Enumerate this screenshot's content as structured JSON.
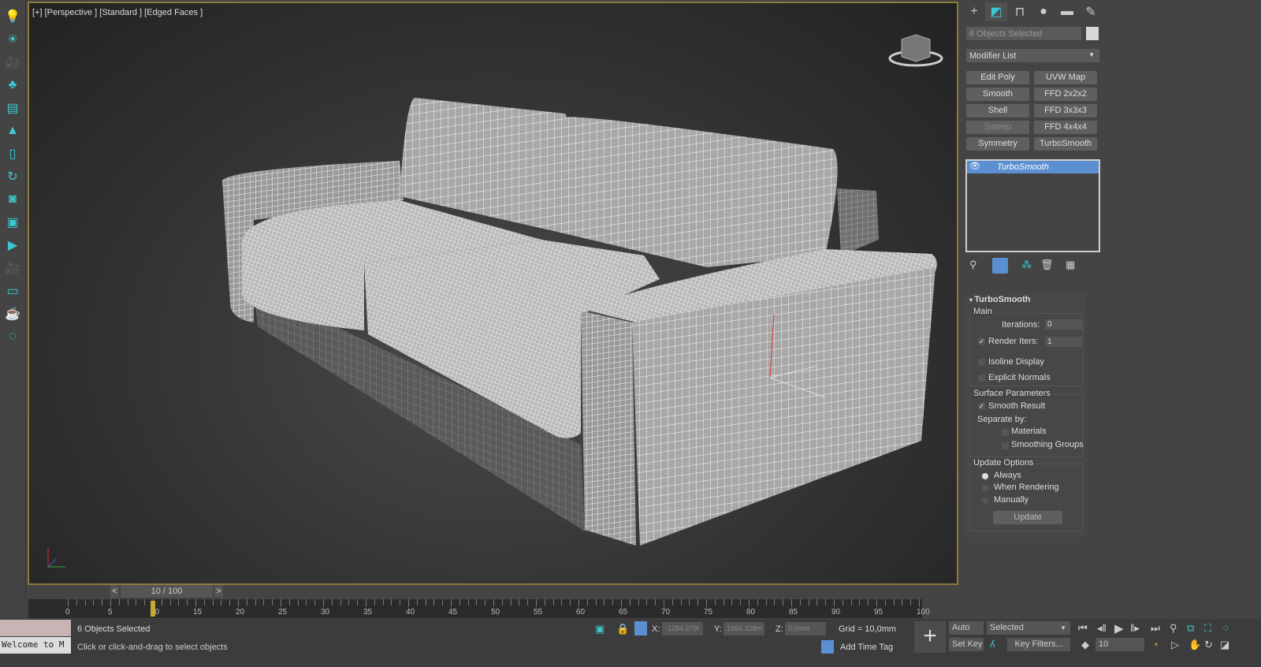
{
  "viewport": {
    "label": "[+] [Perspective ] [Standard ] [Edged Faces ]"
  },
  "left_toolbar": {
    "icons": [
      "lightbulb-icon",
      "sun-icon",
      "camera-icon",
      "trees-icon",
      "tree-panel-icon",
      "tree-icon",
      "tree-card-icon",
      "rotate-icon",
      "layers-icon",
      "play-frame-icon",
      "render-frame-icon",
      "camera-add-icon",
      "panel-icon",
      "teapot-icon",
      "sphere-dots-icon"
    ]
  },
  "command_panel": {
    "tabs": [
      "create",
      "modify",
      "hierarchy",
      "motion",
      "display",
      "utilities"
    ],
    "selection_name": "6 Objects Selected",
    "selection_color": "#d8d8d8",
    "modifier_list": "Modifier List",
    "modifier_buttons": [
      {
        "label": "Edit Poly",
        "enabled": true
      },
      {
        "label": "UVW Map",
        "enabled": true
      },
      {
        "label": "Smooth",
        "enabled": true
      },
      {
        "label": "FFD 2x2x2",
        "enabled": true
      },
      {
        "label": "Shell",
        "enabled": true
      },
      {
        "label": "FFD 3x3x3",
        "enabled": true
      },
      {
        "label": "Sweep",
        "enabled": false
      },
      {
        "label": "FFD 4x4x4",
        "enabled": true
      },
      {
        "label": "Symmetry",
        "enabled": true
      },
      {
        "label": "TurboSmooth",
        "enabled": true
      }
    ],
    "stack": [
      {
        "label": "TurboSmooth",
        "selected": true
      }
    ],
    "rollout": {
      "title": "TurboSmooth",
      "main": {
        "label": "Main",
        "iterations_label": "Iterations:",
        "iterations": "0",
        "render_iters_label": "Render Iters:",
        "render_iters": "1",
        "render_iters_checked": true,
        "isoline": "Isoline Display",
        "isoline_checked": false,
        "explicit": "Explicit Normals",
        "explicit_checked": false
      },
      "surface": {
        "label": "Surface Parameters",
        "smooth_result": "Smooth Result",
        "smooth_checked": true,
        "separate_by": "Separate by:",
        "materials": "Materials",
        "smoothing_groups": "Smoothing Groups"
      },
      "update": {
        "label": "Update Options",
        "always": "Always",
        "when_rendering": "When Rendering",
        "manually": "Manually",
        "selected": "Always",
        "button": "Update"
      }
    }
  },
  "timeline": {
    "slider": "10 / 100",
    "prev": "<",
    "next": ">",
    "current_frame": 10,
    "start": 0,
    "end": 100,
    "ticks": [
      "0",
      "5",
      "10",
      "15",
      "20",
      "25",
      "30",
      "35",
      "40",
      "45",
      "50",
      "55",
      "60",
      "65",
      "70",
      "75",
      "80",
      "85",
      "90",
      "95",
      "100"
    ]
  },
  "status": {
    "listener": "Welcome to M",
    "selected": "6 Objects Selected",
    "prompt": "Click or click-and-drag to select objects",
    "x_label": "X:",
    "x": "-1284,279r",
    "y_label": "Y:",
    "y": "1956,328m",
    "z_label": "Z:",
    "z": "0,0mm",
    "grid": "Grid = 10,0mm",
    "add_time_tag": "Add Time Tag",
    "auto_key": "Auto Key",
    "set_key": "Set Key",
    "key_mode": "Selected",
    "key_filters": "Key Filters...",
    "frame": "10"
  }
}
